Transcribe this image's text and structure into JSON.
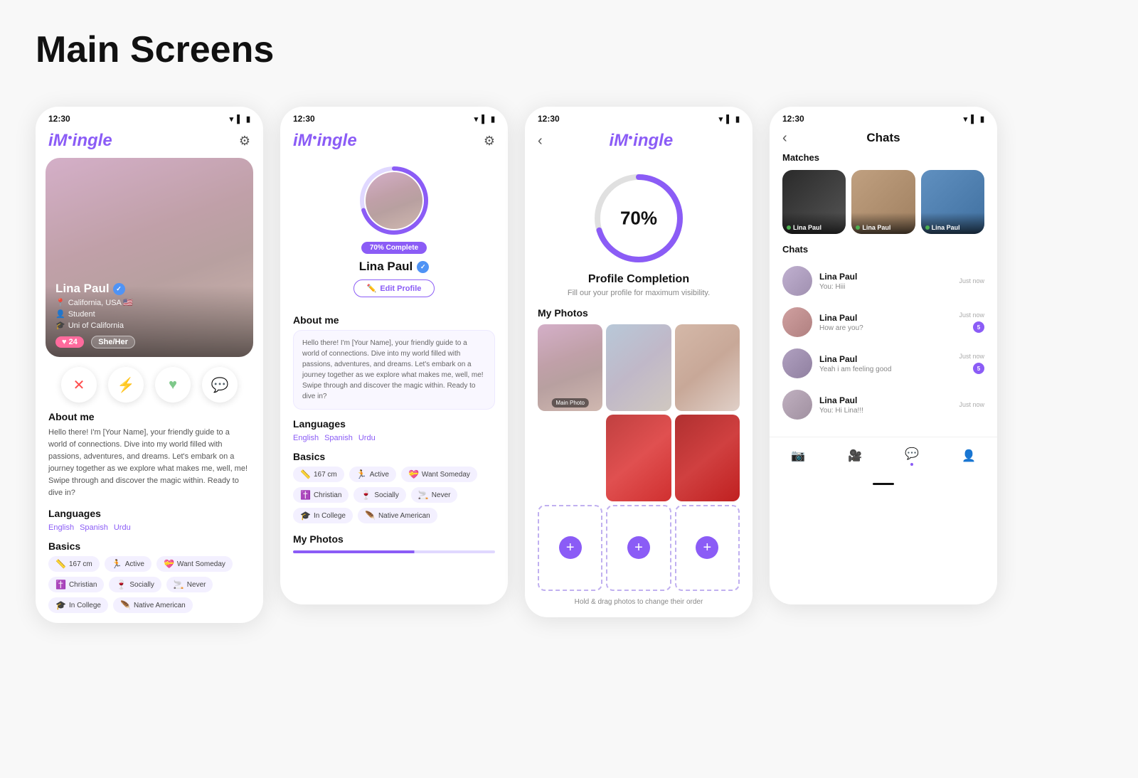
{
  "page": {
    "title": "Main Screens"
  },
  "status_bar": {
    "time": "12:30"
  },
  "screen1": {
    "app_logo": "iMingle",
    "user": {
      "name": "Lina Paul",
      "location": "California, USA 🇺🇸",
      "occupation": "Student",
      "university": "Uni of California",
      "age": "24",
      "pronoun": "She/Her",
      "verified": true
    },
    "actions": {
      "close": "✕",
      "boost": "⚡",
      "heart": "♥",
      "chat": "💬"
    },
    "about_title": "About me",
    "about_text": "Hello there! I'm [Your Name], your friendly guide to a world of connections. Dive into my world filled with passions, adventures, and dreams. Let's embark on a journey together as we explore what makes me, well, me! Swipe through and discover the magic within. Ready to dive in?",
    "languages_title": "Languages",
    "languages": [
      "English",
      "Spanish",
      "Urdu"
    ],
    "basics_title": "Basics",
    "basics": [
      {
        "icon": "📏",
        "label": "167 cm"
      },
      {
        "icon": "🏃",
        "label": "Active"
      },
      {
        "icon": "💝",
        "label": "Want Someday"
      },
      {
        "icon": "✝️",
        "label": "Christian"
      },
      {
        "icon": "🍷",
        "label": "Socially"
      },
      {
        "icon": "🚬",
        "label": "Never"
      },
      {
        "icon": "🎓",
        "label": "In College"
      },
      {
        "icon": "🪶",
        "label": "Native American"
      }
    ]
  },
  "screen2": {
    "app_logo": "iMingle",
    "completion_percent": "70% Complete",
    "user_name": "Lina Paul",
    "edit_profile_btn": "Edit Profile",
    "about_title": "About me",
    "about_text": "Hello there! I'm [Your Name], your friendly guide to a world of connections. Dive into my world filled with passions, adventures, and dreams. Let's embark on a journey together as we explore what makes me, well, me! Swipe through and discover the magic within. Ready to dive in?",
    "languages_title": "Languages",
    "languages": [
      "English",
      "Spanish",
      "Urdu"
    ],
    "basics_title": "Basics",
    "basics": [
      {
        "icon": "📏",
        "label": "167 cm"
      },
      {
        "icon": "🏃",
        "label": "Active"
      },
      {
        "icon": "💝",
        "label": "Want Someday"
      },
      {
        "icon": "✝️",
        "label": "Christian"
      },
      {
        "icon": "🍷",
        "label": "Socially"
      },
      {
        "icon": "🚬",
        "label": "Never"
      },
      {
        "icon": "🎓",
        "label": "In College"
      },
      {
        "icon": "🪶",
        "label": "Native American"
      }
    ],
    "my_photos_title": "My Photos"
  },
  "screen3": {
    "app_logo": "iMingle",
    "back_btn": "‹",
    "completion_percent": "70%",
    "completion_title": "Profile Completion",
    "completion_subtitle": "Fill our your profile for maximum visibility.",
    "my_photos_title": "My Photos",
    "drag_hint": "Hold & drag photos to change their order",
    "main_photo_label": "Main Photo"
  },
  "screen4": {
    "back_btn": "‹",
    "title": "Chats",
    "matches_title": "Matches",
    "matches": [
      {
        "name": "Lina Paul"
      },
      {
        "name": "Lina Paul"
      },
      {
        "name": "Lina Paul"
      }
    ],
    "chats_title": "Chats",
    "chats": [
      {
        "name": "Lina Paul",
        "preview": "You: Hiii",
        "time": "Just now",
        "badge": null
      },
      {
        "name": "Lina Paul",
        "preview": "How are you?",
        "time": "Just now",
        "badge": "5"
      },
      {
        "name": "Lina Paul",
        "preview": "Yeah i am feeling good",
        "time": "Just now",
        "badge": "5"
      },
      {
        "name": "Lina Paul",
        "preview": "You: Hi Lina!!!",
        "time": "Just now",
        "badge": null
      }
    ]
  }
}
